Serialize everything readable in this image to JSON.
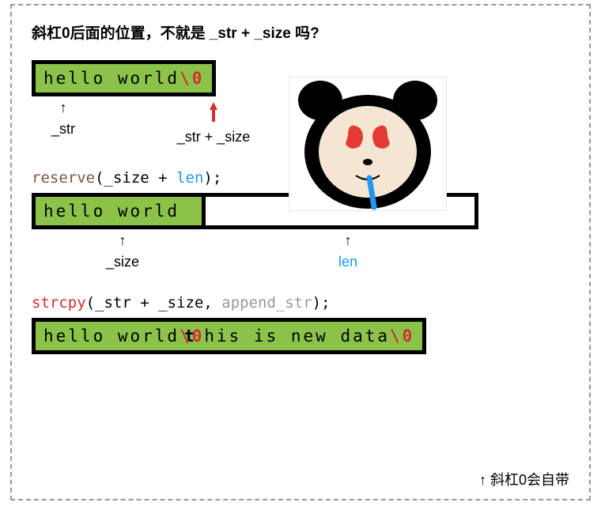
{
  "title": "斜杠0后面的位置，不就是 _str + _size 吗?",
  "box1": {
    "text": "hello world",
    "null": "\\0"
  },
  "arrows1": {
    "left_label": "_str",
    "right_label": "_str + _size"
  },
  "code2": {
    "fn": "reserve",
    "arg1": "_size",
    "plus": " + ",
    "arg2": "len",
    "end": ");"
  },
  "box2": {
    "text": "hello world"
  },
  "arrows2": {
    "left_label": "_size",
    "right_label": "len"
  },
  "code3": {
    "fn": "strcpy",
    "open": "(",
    "arg1": "_str",
    "plus": " + ",
    "arg2": "_size",
    "comma": ", ",
    "arg3": "append_str",
    "end": ");"
  },
  "box3": {
    "text1": "hello world",
    "null1": "\\0",
    "overlap": "t",
    "text2": "his is new data",
    "null2": "\\0"
  },
  "footer": "↑ 斜杠0会自带"
}
